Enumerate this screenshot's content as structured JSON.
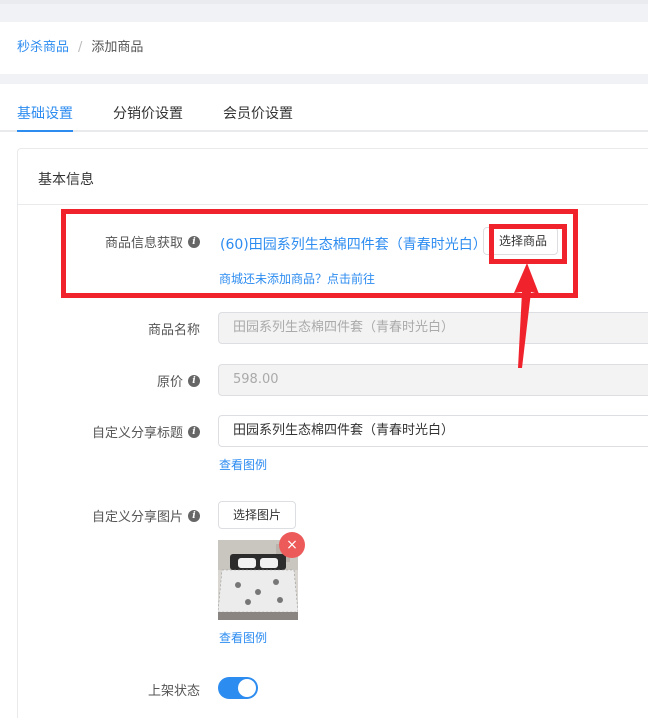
{
  "breadcrumb": {
    "parent": "秒杀商品",
    "separator": "/",
    "current": "添加商品"
  },
  "tabs": [
    {
      "label": "基础设置",
      "active": true
    },
    {
      "label": "分销价设置",
      "active": false
    },
    {
      "label": "会员价设置",
      "active": false
    }
  ],
  "card": {
    "title": "基本信息"
  },
  "form": {
    "goods_fetch": {
      "label": "商品信息获取",
      "selected_goods": "(60)田园系列生态棉四件套（青春时光白）",
      "select_button": "选择商品",
      "hint_link": "商城还未添加商品？点击前往"
    },
    "goods_name": {
      "label": "商品名称",
      "value": "田园系列生态棉四件套（青春时光白）",
      "disabled": true
    },
    "original_price": {
      "label": "原价",
      "value": "598.00",
      "disabled": true
    },
    "share_title": {
      "label": "自定义分享标题",
      "value": "田园系列生态棉四件套（青春时光白）",
      "example_link": "查看图例"
    },
    "share_image": {
      "label": "自定义分享图片",
      "select_button": "选择图片",
      "remove_symbol": "×",
      "example_link": "查看图例"
    },
    "shelf_status": {
      "label": "上架状态",
      "on": true
    }
  },
  "colors": {
    "accent": "#2d8cf0",
    "annotation_red": "#f0232d",
    "remove_badge": "#ed5a5a"
  }
}
